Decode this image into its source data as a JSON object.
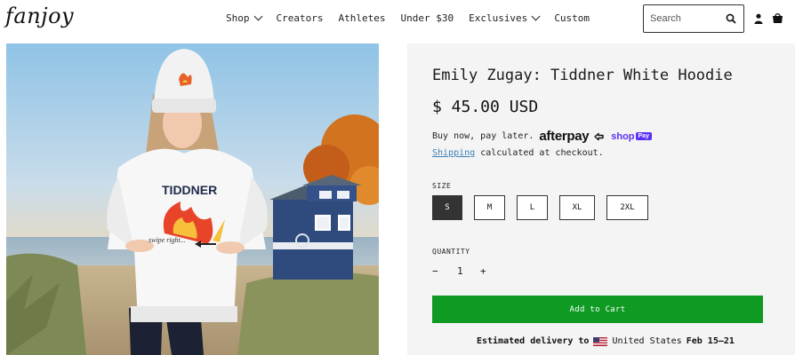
{
  "brand": {
    "logo_text": "fanjoy"
  },
  "nav": {
    "items": [
      {
        "label": "Shop",
        "has_dropdown": true
      },
      {
        "label": "Creators",
        "has_dropdown": false
      },
      {
        "label": "Athletes",
        "has_dropdown": false
      },
      {
        "label": "Under $30",
        "has_dropdown": false
      },
      {
        "label": "Exclusives",
        "has_dropdown": true
      },
      {
        "label": "Custom",
        "has_dropdown": false
      }
    ]
  },
  "search": {
    "placeholder": "Search",
    "icon": "search-icon"
  },
  "header_icons": [
    "user-icon",
    "cart-icon"
  ],
  "product": {
    "title": "Emily Zugay: Tiddner White Hoodie",
    "price": "$ 45.00 USD",
    "bnpl_text": "Buy now, pay later.",
    "afterpay_label": "afterpay",
    "shoppay_label": "shop",
    "shoppay_badge": "Pay",
    "shipping_link": "Shipping",
    "shipping_text": " calculated at checkout.",
    "image_print_title": "TIDDNER",
    "image_print_caption": "swipe right...",
    "size_label": "SIZE",
    "sizes": [
      "S",
      "M",
      "L",
      "XL",
      "2XL"
    ],
    "selected_size": "S",
    "quantity_label": "QUANTITY",
    "quantity": "1",
    "qty_minus": "−",
    "qty_plus": "+",
    "add_to_cart": "Add to Cart",
    "delivery_prefix": "Estimated delivery to",
    "delivery_country": "United States",
    "delivery_dates": "Feb 15–21"
  },
  "colors": {
    "add_to_cart_bg": "#0e9a23",
    "panel_bg": "#f4f4f4",
    "link": "#3a7fb5",
    "shoppay": "#5a31f4"
  }
}
